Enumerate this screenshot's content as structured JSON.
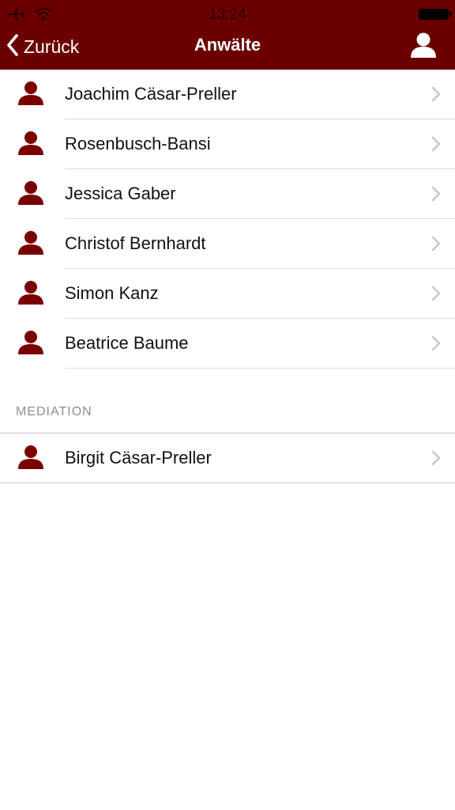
{
  "status_bar": {
    "time": "13:24",
    "icons": [
      "airplane-icon",
      "wifi-icon",
      "battery-icon"
    ]
  },
  "nav": {
    "back_label": "Zurück",
    "title": "Anwälte",
    "right_icon": "person-icon"
  },
  "colors": {
    "bar_background": "#6b0000",
    "icon_color": "#7a0000",
    "section_label": "#8e8e93",
    "chevron": "#c7c7cc"
  },
  "lawyers": [
    {
      "name": "Joachim Cäsar-Preller"
    },
    {
      "name": "Rosenbusch-Bansi"
    },
    {
      "name": "Jessica Gaber"
    },
    {
      "name": "Christof Bernhardt"
    },
    {
      "name": "Simon Kanz"
    },
    {
      "name": "Beatrice Baume"
    }
  ],
  "mediation": {
    "header": "MEDIATION",
    "items": [
      {
        "name": "Birgit Cäsar-Preller"
      }
    ]
  }
}
